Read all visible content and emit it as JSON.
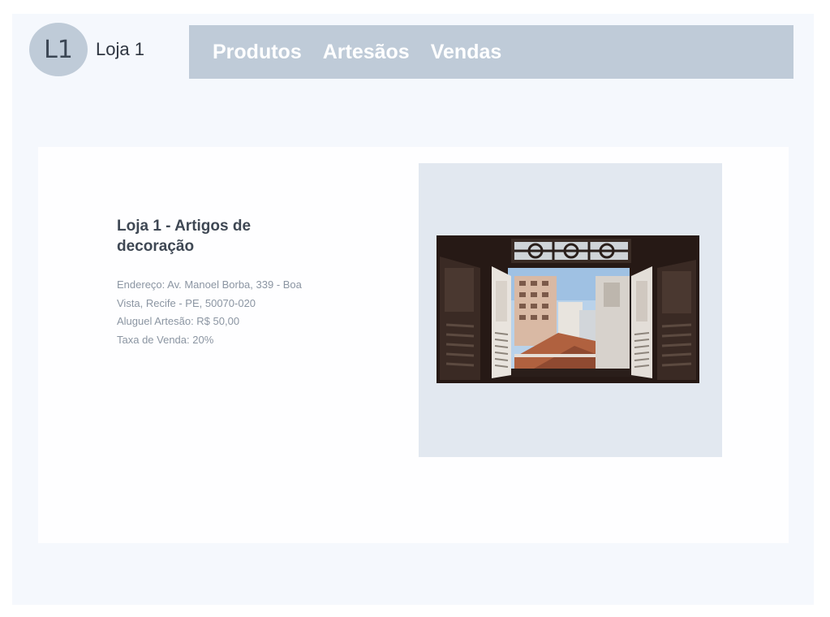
{
  "header": {
    "avatar_initials": "L1",
    "store_name": "Loja 1"
  },
  "nav": {
    "items": [
      {
        "label": "Produtos"
      },
      {
        "label": "Artesãos"
      },
      {
        "label": "Vendas"
      }
    ]
  },
  "store": {
    "title": "Loja 1 - Artigos de decoração",
    "address": "Endereço: Av. Manoel Borba, 339 - Boa Vista, Recife - PE, 50070-020",
    "rent": "Aluguel Artesão: R$ 50,00",
    "fee": "Taxa de Venda: 20%"
  },
  "photo": {
    "subject": "open window with shutters overlooking city buildings"
  },
  "colors": {
    "page_bg": "#f5f8fd",
    "nav_bg": "#bfcbd8",
    "card_bg": "#fefeff",
    "image_panel_bg": "#e2e8f0"
  }
}
